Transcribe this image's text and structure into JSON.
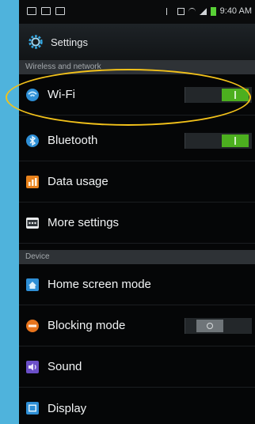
{
  "status_bar": {
    "time": "9:40 AM"
  },
  "header": {
    "title": "Settings",
    "icon": "gear-icon"
  },
  "sections": {
    "wireless": "Wireless and network",
    "device": "Device"
  },
  "rows": {
    "wifi": {
      "label": "Wi-Fi",
      "icon": "wifi-icon",
      "toggle": "on"
    },
    "bluetooth": {
      "label": "Bluetooth",
      "icon": "bluetooth-icon",
      "toggle": "on"
    },
    "data_usage": {
      "label": "Data usage",
      "icon": "data-usage-icon"
    },
    "more_settings": {
      "label": "More settings",
      "icon": "more-settings-icon"
    },
    "home_screen_mode": {
      "label": "Home screen mode",
      "icon": "home-icon"
    },
    "blocking_mode": {
      "label": "Blocking mode",
      "icon": "blocking-icon",
      "toggle": "off"
    },
    "sound": {
      "label": "Sound",
      "icon": "sound-icon"
    },
    "display": {
      "label": "Display",
      "icon": "display-icon"
    }
  },
  "colors": {
    "highlight": "#f3c21a",
    "toggle_on": "#4caf1f",
    "background": "#4fb3dc"
  }
}
